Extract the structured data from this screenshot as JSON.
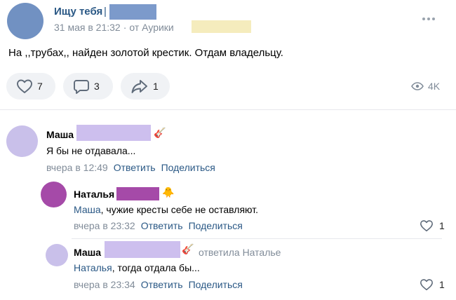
{
  "post": {
    "group_name": "Ищу тебя",
    "separator": "|",
    "date": "31 мая в 21:32",
    "dot": "·",
    "from_label": "от Аурики",
    "text": "На ,,трубах,, найден золотой крестик. Отдам владельцу.",
    "likes": "7",
    "comments": "3",
    "shares": "1",
    "views": "4K"
  },
  "comments": [
    {
      "author": "Маша",
      "emoji": "🎸",
      "text": "Я бы не отдавала...",
      "time": "вчера в 12:49",
      "reply": "Ответить",
      "share": "Поделиться"
    },
    {
      "author": "Наталья",
      "emoji": "🐥",
      "mention": "Маша",
      "text": ", чужие кресты себе не оставляют.",
      "time": "вчера в 23:32",
      "reply": "Ответить",
      "share": "Поделиться",
      "likes": "1"
    },
    {
      "author": "Маша",
      "emoji": "🎸",
      "reply_to": "ответила Наталье",
      "mention": "Наталья",
      "text": ", тогда отдала бы...",
      "time": "вчера в 23:34",
      "reply": "Ответить",
      "share": "Поделиться",
      "likes": "1"
    }
  ],
  "colors": {
    "link": "#2a5885",
    "meta": "#818c99",
    "action_bg": "#f0f2f5"
  },
  "icons": [
    "heart-icon",
    "comment-icon",
    "share-arrow-icon",
    "eye-icon",
    "more-dots-icon"
  ]
}
